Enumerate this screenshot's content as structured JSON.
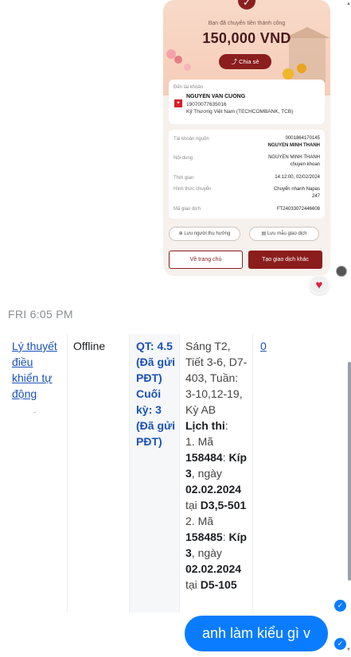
{
  "receipt": {
    "subtitle": "Bạn đã chuyển tiền thành công",
    "amount": "150,000 VND",
    "share_label": "Chia sẻ",
    "recipient_label": "Đến tài khoản",
    "recipient_name": "NGUYEN VAN CUONG",
    "recipient_account": "19070077635016",
    "recipient_bank": "Kỹ Thương Việt Nam (TECHCOMBANK, TCB)",
    "details": [
      {
        "label": "Tài khoản nguồn",
        "value": "0001864170145",
        "value2": "NGUYEN MINH THANH"
      },
      {
        "label": "Nội dung",
        "value": "NGUYEN MINH THANH",
        "value2": "chuyen khoan"
      },
      {
        "label": "Thời gian",
        "value": "14:12:00, 02/02/2024",
        "value2": ""
      },
      {
        "label": "Hình thức chuyển",
        "value": "Chuyển nhanh Napas",
        "value2": "247"
      },
      {
        "label": "Mã giao dịch",
        "value": "FT24033072446608",
        "value2": ""
      }
    ],
    "save_recipient": "Lưu người thụ hưởng",
    "save_template": "Lưu mẫu giao dịch",
    "home_button": "Về trang chủ",
    "new_transaction_button": "Tạo giao dịch khác"
  },
  "reaction": {
    "icon": "heart-icon",
    "color": "#e41e3f"
  },
  "timestamp": "FRI 6:05 PM",
  "table_row": {
    "course": "Lý thuyết điều khiển tự động",
    "mode": "Offline",
    "grades_lines": [
      "QT: 4.5",
      "(Đã gửi",
      "PĐT)",
      "Cuối",
      "kỳ: 3",
      "(Đã gửi",
      "PĐT)"
    ],
    "schedule": {
      "line1": "Sáng T2, Tiết 3-6, D7-403, Tuần: 3-10,12-19, Kỳ AB",
      "exam_title": "Lịch thi",
      "exam1_prefix": "1. Mã ",
      "exam1_code": "158484",
      "exam1_sep": ": ",
      "exam1_kip": "Kíp 3",
      "exam1_date_prefix": ", ngày ",
      "exam1_date": "02.02.2024",
      "exam1_room_prefix": " tại ",
      "exam1_room": "D3,5-501",
      "exam2_prefix": "2. Mã ",
      "exam2_code": "158485",
      "exam2_sep": ": ",
      "exam2_kip": "Kíp 3",
      "exam2_date_prefix": ", ngày ",
      "exam2_date": "02.02.2024",
      "exam2_room_prefix": " tại ",
      "exam2_room": "D5-105"
    },
    "count": "0"
  },
  "outgoing_message": "anh làm kiểu gì v",
  "colors": {
    "accent": "#0a7cff",
    "brand_dark_red": "#8b1d1d",
    "link": "#1a52b8"
  }
}
